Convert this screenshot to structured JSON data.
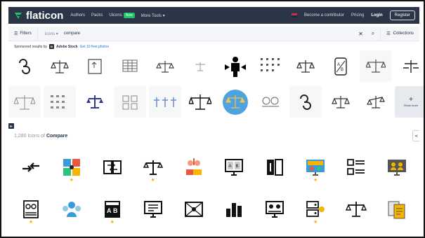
{
  "nav": {
    "logo_text": "flaticon",
    "links": [
      "Authors",
      "Packs",
      "Uicons",
      "More Tools"
    ],
    "uicons_badge": "New",
    "contributor": "Become a contributor",
    "pricing": "Pricing",
    "login": "Login",
    "register": "Register"
  },
  "search": {
    "filters_label": "Filters",
    "category": "Icons",
    "query": "compare",
    "collections_label": "Collections"
  },
  "sponsored": {
    "prefix": "Sponsored results by",
    "brand": "Adobe Stock",
    "link": "Get 10 free photos",
    "row1_captions": [
      "",
      "",
      "",
      "",
      "",
      "",
      "",
      "",
      "",
      "",
      "",
      ""
    ],
    "show_more": "Show more"
  },
  "results": {
    "count": "1,280",
    "middle": "Icons of",
    "query": "Compare"
  },
  "colors": {
    "nav_bg": "#2a3645",
    "logo_green": "#1fc36c",
    "star": "#f5b400",
    "link": "#1b6fd8"
  },
  "icons": {
    "row1": [
      {
        "name": "arrows-exchange-icon",
        "premium": false
      },
      {
        "name": "puzzle-compare-icon",
        "premium": true
      },
      {
        "name": "swap-boxes-icon",
        "premium": false
      },
      {
        "name": "balance-scale-icon",
        "premium": true
      },
      {
        "name": "people-compare-icon",
        "premium": false
      },
      {
        "name": "ab-monitor-icon",
        "premium": false
      },
      {
        "name": "split-compare-icon",
        "premium": false
      },
      {
        "name": "monitor-compare-icon",
        "premium": true
      },
      {
        "name": "checklist-compare-icon",
        "premium": false
      },
      {
        "name": "computer-users-icon",
        "premium": false
      }
    ],
    "row2": [
      {
        "name": "document-users-icon",
        "premium": true
      },
      {
        "name": "team-compare-icon",
        "premium": false
      },
      {
        "name": "ab-test-icon",
        "premium": true
      },
      {
        "name": "monitor-tools-icon",
        "premium": false
      },
      {
        "name": "image-compare-icon",
        "premium": false
      },
      {
        "name": "bar-chart-icon",
        "premium": false
      },
      {
        "name": "computer-network-icon",
        "premium": false
      },
      {
        "name": "server-compare-icon",
        "premium": true
      },
      {
        "name": "scale-weight-icon",
        "premium": false
      },
      {
        "name": "file-compare-icon",
        "premium": false
      }
    ]
  }
}
